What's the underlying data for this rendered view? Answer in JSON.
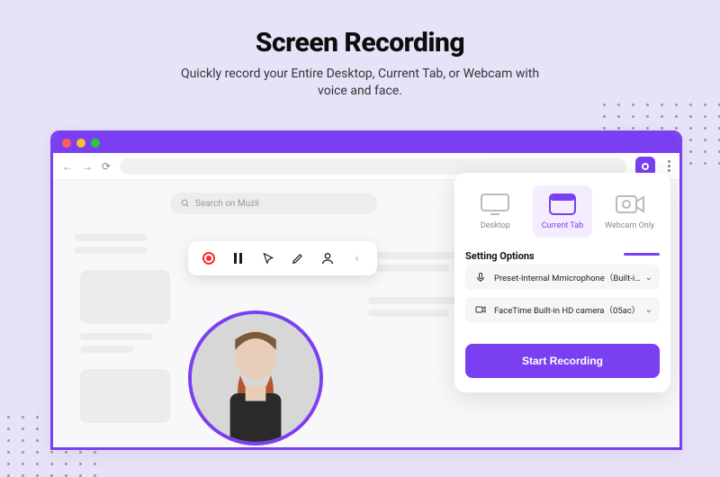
{
  "hero": {
    "title": "Screen Recording",
    "subtitle_line1": "Quickly record your Entire Desktop, Current Tab, or Webcam with",
    "subtitle_line2": "voice and face."
  },
  "browser": {
    "search_placeholder": "Search on Muzli"
  },
  "panel": {
    "modes": [
      {
        "label": "Desktop",
        "icon": "desktop-icon",
        "active": false
      },
      {
        "label": "Current Tab",
        "icon": "tab-icon",
        "active": true
      },
      {
        "label": "Webcam Only",
        "icon": "webcam-icon",
        "active": false
      }
    ],
    "section_title": "Setting Options",
    "mic_label": "Preset-Internal Mmicrophone（Built-in）",
    "cam_label": "FaceTime Built-in HD camera（05ac）",
    "start_button": "Start Recording"
  },
  "colors": {
    "accent": "#7b3ff2"
  }
}
